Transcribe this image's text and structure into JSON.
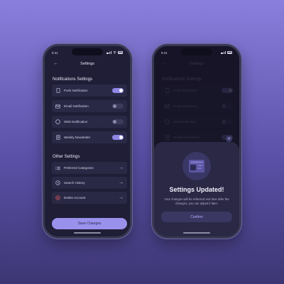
{
  "status": {
    "time": "9:41"
  },
  "header": {
    "title": "Settings"
  },
  "notifications": {
    "title": "Notifications Settings",
    "items": [
      {
        "label": "Push Notification",
        "on": true,
        "icon": "phone-icon"
      },
      {
        "label": "Email Notification",
        "on": false,
        "icon": "mail-icon"
      },
      {
        "label": "SMS Notification",
        "on": false,
        "icon": "chat-icon"
      },
      {
        "label": "Weekly Newsletter",
        "on": true,
        "icon": "newsletter-icon"
      }
    ]
  },
  "other": {
    "title": "Other Settings",
    "items": [
      {
        "label": "Preferred Categories",
        "icon": "list-icon"
      },
      {
        "label": "Search History",
        "icon": "history-icon"
      },
      {
        "label": "Delete Account",
        "icon": "delete-icon",
        "color": "#e05a5a"
      }
    ]
  },
  "save_label": "Save Changes",
  "modal": {
    "title": "Settings Updated!",
    "body": "Your changes will be reflected real time after the changes, you can adjust it later.",
    "confirm_label": "Confirm",
    "close_symbol": "✕"
  },
  "colors": {
    "accent": "#9a91ec",
    "danger": "#e05a5a",
    "background": "#1f1e36"
  }
}
